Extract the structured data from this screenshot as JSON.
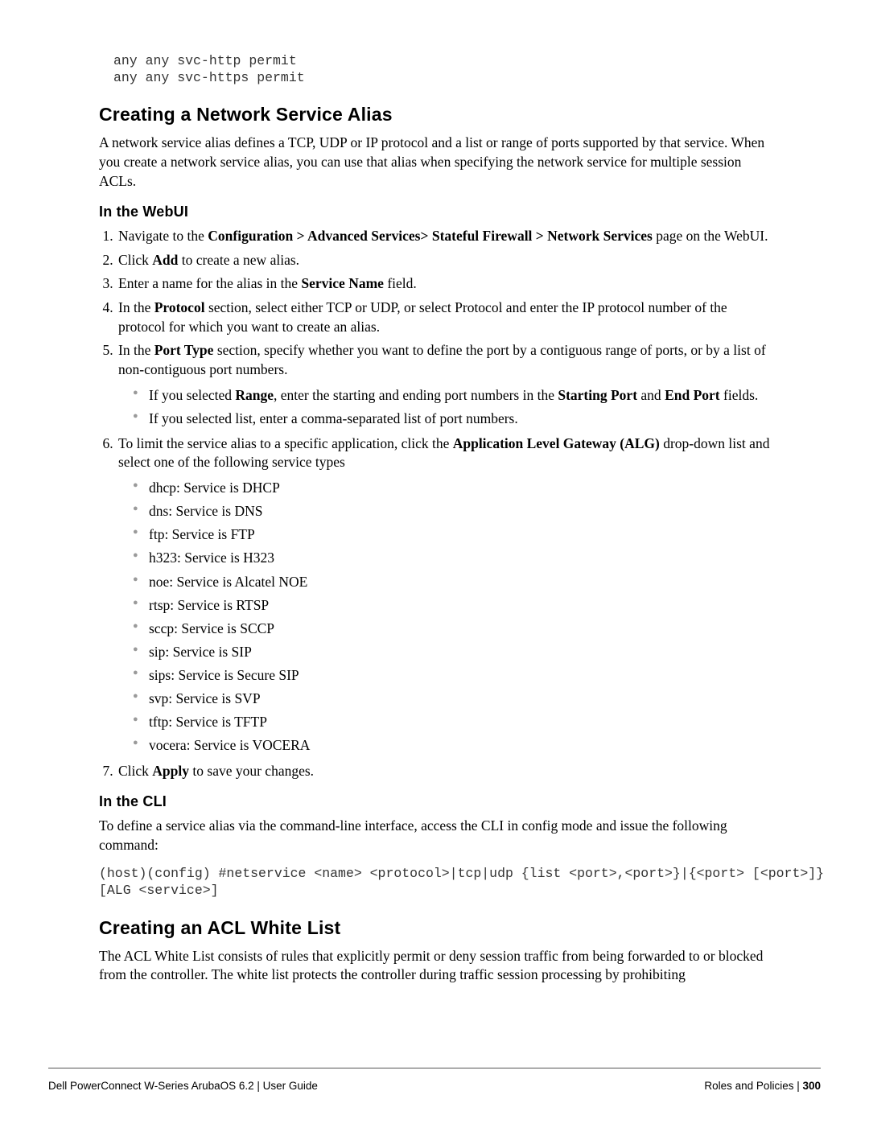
{
  "codeblock_top": "any any svc-http permit\nany any svc-https permit",
  "h2_alias": "Creating a Network Service Alias",
  "p_alias_intro": "A network service alias defines a TCP, UDP or IP protocol and a list or range of ports supported by that service. When you create a network service alias, you can use that alias when specifying the network service for multiple session ACLs.",
  "h3_webui": "In the WebUI",
  "step1_a": "Navigate to the ",
  "step1_b": "Configuration > Advanced Services> Stateful Firewall > Network Services",
  "step1_c": " page on the WebUI.",
  "step2_a": "Click ",
  "step2_b": "Add",
  "step2_c": " to create a new alias.",
  "step3_a": "Enter a name for the alias in the ",
  "step3_b": "Service Name",
  "step3_c": " field.",
  "step4_a": "In the ",
  "step4_b": "Protocol",
  "step4_c": " section, select either TCP or UDP, or select Protocol and enter the IP protocol number of the protocol for which you want to create an alias.",
  "step5_a": "In the ",
  "step5_b": "Port Type",
  "step5_c": " section, specify whether you want to define the port by a contiguous range of ports, or by a list of non-contiguous port numbers.",
  "step5_sub1_a": "If you selected ",
  "step5_sub1_b": "Range",
  "step5_sub1_c": ", enter the starting and ending port numbers in the ",
  "step5_sub1_d": "Starting Port",
  "step5_sub1_e": " and ",
  "step5_sub1_f": "End Port",
  "step5_sub1_g": " fields.",
  "step5_sub2": "If you selected list, enter a comma-separated list of port numbers.",
  "step6_a": "To limit the service alias to a specific application, click the ",
  "step6_b": "Application Level Gateway (ALG)",
  "step6_c": " drop-down list and select one of the following service types",
  "svc_dhcp": "dhcp:  Service is DHCP",
  "svc_dns": "dns:  Service is DNS",
  "svc_ftp": "ftp:  Service is FTP",
  "svc_h323": "h323:  Service is H323",
  "svc_noe": "noe:  Service is Alcatel NOE",
  "svc_rtsp": "rtsp:  Service is RTSP",
  "svc_sccp": "sccp:  Service is SCCP",
  "svc_sip": "sip:  Service is SIP",
  "svc_sips": "sips:  Service is Secure SIP",
  "svc_svp": "svp:  Service is SVP",
  "svc_tftp": "tftp:  Service is TFTP",
  "svc_vocera": "vocera:  Service is VOCERA",
  "step7_a": "Click ",
  "step7_b": "Apply",
  "step7_c": " to save your changes.",
  "h3_cli": "In the CLI",
  "p_cli": "To define a service alias via the command-line interface, access the CLI in config mode and issue the following command:",
  "codeblock_cli": "(host)(config) #netservice <name> <protocol>|tcp|udp {list <port>,<port>}|{<port> [<port>]}\n[ALG <service>]",
  "h2_whitelist": "Creating an ACL White List",
  "p_whitelist": "The ACL White List consists of rules that explicitly permit or deny session traffic from being forwarded to or blocked from the controller. The white list protects the controller during traffic session processing by prohibiting",
  "footer_left": "Dell PowerConnect W-Series ArubaOS 6.2 ",
  "footer_left2": "|",
  "footer_left3": " User Guide",
  "footer_right_a": "Roles and Policies ",
  "footer_right_b": "|",
  "footer_right_c": " 300"
}
